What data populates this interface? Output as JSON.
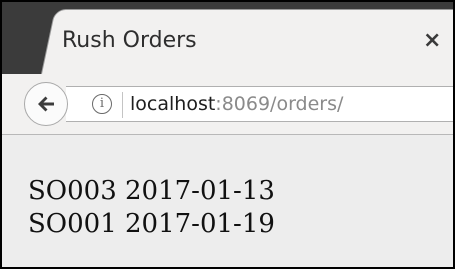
{
  "tab": {
    "title": "Rush Orders",
    "close_glyph": "×"
  },
  "toolbar": {
    "back_icon": "back-arrow-icon",
    "info_icon": "info-icon",
    "info_glyph": "i",
    "url_host": "localhost",
    "url_rest": ":8069/orders/"
  },
  "orders": [
    {
      "text": "SO003 2017-01-13"
    },
    {
      "text": "SO001 2017-01-19"
    }
  ]
}
